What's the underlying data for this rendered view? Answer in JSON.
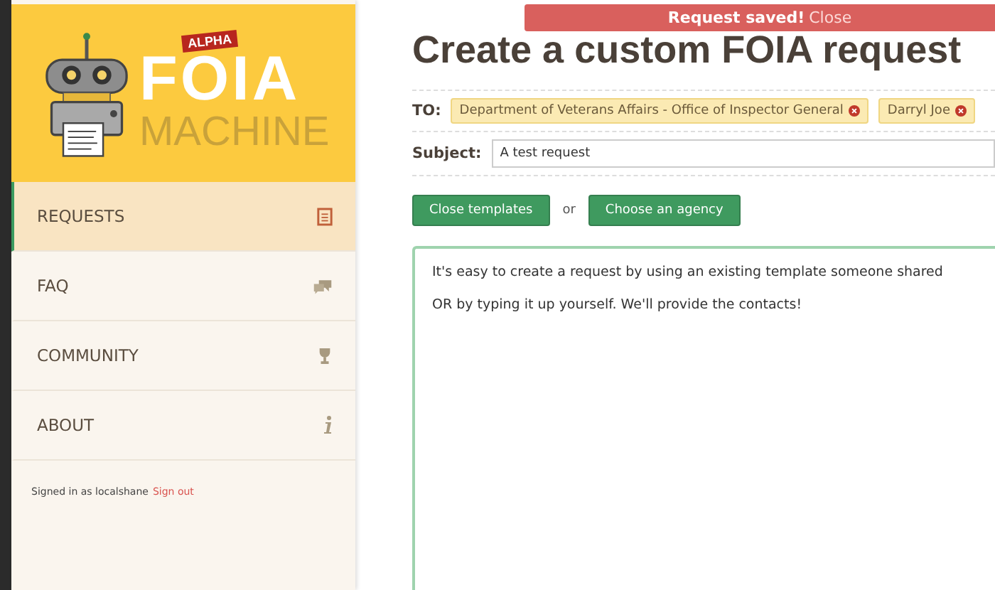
{
  "notice": {
    "message": "Request saved!",
    "close": "Close"
  },
  "logo": {
    "title": "FOIA",
    "badge": "ALPHA",
    "subtitle": "MACHINE"
  },
  "sidebar": {
    "items": [
      {
        "label": "REQUESTS",
        "kind": "document",
        "selected": true
      },
      {
        "label": "FAQ",
        "kind": "chat",
        "selected": false
      },
      {
        "label": "COMMUNITY",
        "kind": "trophy",
        "selected": false
      },
      {
        "label": "ABOUT",
        "kind": "info",
        "selected": false
      }
    ],
    "signed_in": "Signed in as localshane",
    "sign_out": "Sign out"
  },
  "page": {
    "title": "Create a custom FOIA request",
    "to_label": "TO:",
    "recipients": [
      "Department of Veterans Affairs - Office of Inspector General",
      "Darryl Joe"
    ],
    "subject_label": "Subject:",
    "subject": "A test request",
    "buttons": [
      "Close templates",
      "Choose an agency"
    ],
    "or": "or",
    "body": [
      "It's easy to create a request by using an existing template someone shared",
      "OR by typing it up yourself. We'll provide the contacts!"
    ]
  }
}
